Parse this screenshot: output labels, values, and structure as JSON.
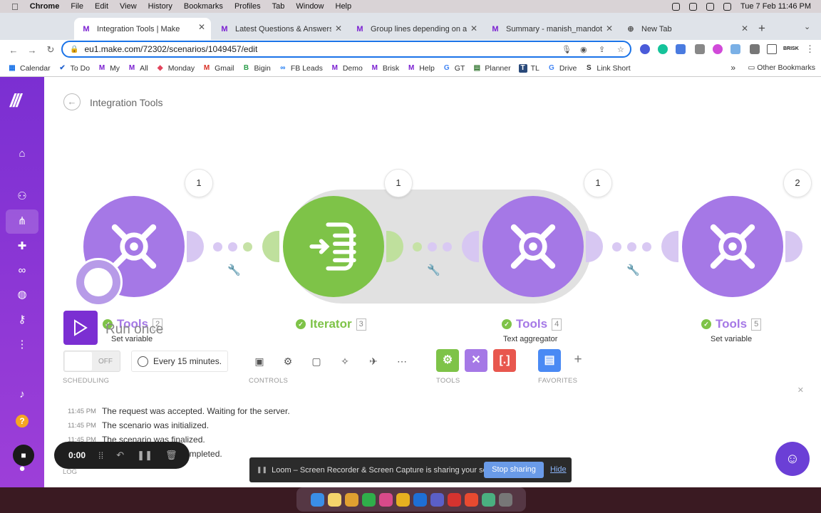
{
  "menubar": {
    "app": "Chrome",
    "menus": [
      "Chrome",
      "File",
      "Edit",
      "View",
      "History",
      "Bookmarks",
      "Profiles",
      "Tab",
      "Window",
      "Help"
    ],
    "datetime": "Tue 7 Feb  11:46 PM"
  },
  "tabs": [
    {
      "title": "Integration Tools | Make",
      "favicon": "make-icon",
      "active": true
    },
    {
      "title": "Latest Questions & Answers to",
      "favicon": "make-icon"
    },
    {
      "title": "Group lines depending on a co",
      "favicon": "make-icon"
    },
    {
      "title": "Summary - manish_mandot - M",
      "favicon": "make-icon"
    },
    {
      "title": "New Tab",
      "favicon": "globe-icon"
    }
  ],
  "url": "eu1.make.com/72302/scenarios/1049457/edit",
  "bookmarks": [
    "Calendar",
    "To Do",
    "My",
    "All",
    "Monday",
    "Gmail",
    "Bigin",
    "FB Leads",
    "Demo",
    "Brisk",
    "Help",
    "GT",
    "Planner",
    "TL",
    "Drive",
    "Link Short"
  ],
  "other_bookmarks": "Other Bookmarks",
  "scenario": {
    "title": "Integration Tools"
  },
  "modules": [
    {
      "name": "Tools",
      "number": "2",
      "subtitle": "Set variable",
      "ops": "1",
      "kind": "tools"
    },
    {
      "name": "Iterator",
      "number": "3",
      "subtitle": "",
      "ops": "1",
      "kind": "iterator"
    },
    {
      "name": "Tools",
      "number": "4",
      "subtitle": "Text aggregator",
      "ops": "1",
      "kind": "tools"
    },
    {
      "name": "Tools",
      "number": "5",
      "subtitle": "Set variable",
      "ops": "2",
      "kind": "tools"
    }
  ],
  "run_once": "Run once",
  "scheduling": {
    "toggle": "OFF",
    "interval": "Every 15 minutes.",
    "label": "SCHEDULING"
  },
  "controls_label": "CONTROLS",
  "tools_label": "TOOLS",
  "favorites_label": "FAVORITES",
  "log": {
    "label": "LOG",
    "entries": [
      {
        "time": "11:45 PM",
        "text": "The request was accepted. Waiting for the server."
      },
      {
        "time": "11:45 PM",
        "text": "The scenario was initialized."
      },
      {
        "time": "11:45 PM",
        "text": "The scenario was finalized."
      },
      {
        "time": "",
        "text": "ompleted."
      }
    ]
  },
  "recorder": {
    "time": "0:00"
  },
  "loom": {
    "message": "Loom – Screen Recorder & Screen Capture is sharing your screen.",
    "stop": "Stop sharing",
    "hide": "Hide"
  },
  "colors": {
    "brand": "#7b2fd2",
    "tools": "#a578e6",
    "iterator": "#7ec348",
    "accent": "#1a73e8"
  },
  "extension_label": "BRISK"
}
